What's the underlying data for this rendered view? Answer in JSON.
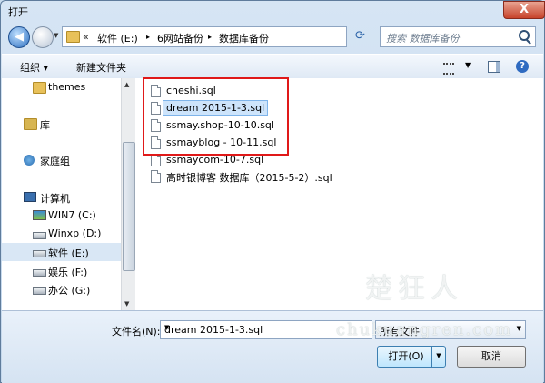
{
  "window": {
    "title": "打开",
    "close_label": "X"
  },
  "nav": {
    "back_label": "◀"
  },
  "address": {
    "prefix": "«",
    "crumbs": [
      "软件 (E:)",
      "6网站备份",
      "数据库备份"
    ],
    "separators": [
      "▸",
      "▸"
    ]
  },
  "search": {
    "placeholder": "搜索 数据库备份"
  },
  "toolbar": {
    "organize_label": "组织 ▾",
    "new_folder_label": "新建文件夹",
    "help_label": "?"
  },
  "sidebar": {
    "items": [
      {
        "label": "themes",
        "icon": "folder-icon"
      },
      {
        "label": "库",
        "icon": "library-icon"
      },
      {
        "label": "家庭组",
        "icon": "homegroup-icon"
      },
      {
        "label": "计算机",
        "icon": "computer-icon"
      },
      {
        "label": "WIN7 (C:)",
        "icon": "drive-icon"
      },
      {
        "label": "Winxp (D:)",
        "icon": "drive-icon"
      },
      {
        "label": "软件 (E:)",
        "icon": "drive-icon"
      },
      {
        "label": "娱乐 (F:)",
        "icon": "drive-icon"
      },
      {
        "label": "办公 (G:)",
        "icon": "drive-icon"
      }
    ]
  },
  "files": [
    {
      "name": "cheshi.sql"
    },
    {
      "name": "dream 2015-1-3.sql"
    },
    {
      "name": "ssmay.shop-10-10.sql"
    },
    {
      "name": "ssmayblog - 10-11.sql"
    },
    {
      "name": "ssmaycom-10-7.sql"
    },
    {
      "name": "高时银博客 数据库（2015-5-2）.sql"
    }
  ],
  "footer": {
    "filename_label": "文件名(N):",
    "filename_value": "dream 2015-1-3.sql",
    "filter_value": "所有文件",
    "open_label": "打开(O)",
    "cancel_label": "取消"
  },
  "watermark": {
    "text": "楚狂人",
    "url": "chukuangren.com"
  },
  "colors": {
    "highlight_box": "#e01919",
    "selection": "#cde4fb"
  }
}
